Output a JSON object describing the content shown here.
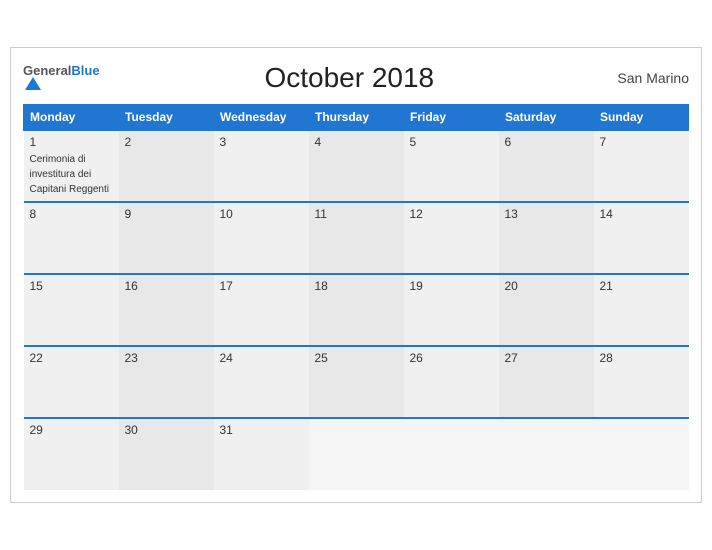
{
  "header": {
    "logo_general": "General",
    "logo_blue": "Blue",
    "title": "October 2018",
    "country": "San Marino"
  },
  "weekdays": [
    "Monday",
    "Tuesday",
    "Wednesday",
    "Thursday",
    "Friday",
    "Saturday",
    "Sunday"
  ],
  "weeks": [
    [
      {
        "day": "1",
        "event": "Cerimonia di investitura dei Capitani Reggenti"
      },
      {
        "day": "2",
        "event": ""
      },
      {
        "day": "3",
        "event": ""
      },
      {
        "day": "4",
        "event": ""
      },
      {
        "day": "5",
        "event": ""
      },
      {
        "day": "6",
        "event": ""
      },
      {
        "day": "7",
        "event": ""
      }
    ],
    [
      {
        "day": "8",
        "event": ""
      },
      {
        "day": "9",
        "event": ""
      },
      {
        "day": "10",
        "event": ""
      },
      {
        "day": "11",
        "event": ""
      },
      {
        "day": "12",
        "event": ""
      },
      {
        "day": "13",
        "event": ""
      },
      {
        "day": "14",
        "event": ""
      }
    ],
    [
      {
        "day": "15",
        "event": ""
      },
      {
        "day": "16",
        "event": ""
      },
      {
        "day": "17",
        "event": ""
      },
      {
        "day": "18",
        "event": ""
      },
      {
        "day": "19",
        "event": ""
      },
      {
        "day": "20",
        "event": ""
      },
      {
        "day": "21",
        "event": ""
      }
    ],
    [
      {
        "day": "22",
        "event": ""
      },
      {
        "day": "23",
        "event": ""
      },
      {
        "day": "24",
        "event": ""
      },
      {
        "day": "25",
        "event": ""
      },
      {
        "day": "26",
        "event": ""
      },
      {
        "day": "27",
        "event": ""
      },
      {
        "day": "28",
        "event": ""
      }
    ],
    [
      {
        "day": "29",
        "event": ""
      },
      {
        "day": "30",
        "event": ""
      },
      {
        "day": "31",
        "event": ""
      },
      {
        "day": "",
        "event": ""
      },
      {
        "day": "",
        "event": ""
      },
      {
        "day": "",
        "event": ""
      },
      {
        "day": "",
        "event": ""
      }
    ]
  ]
}
